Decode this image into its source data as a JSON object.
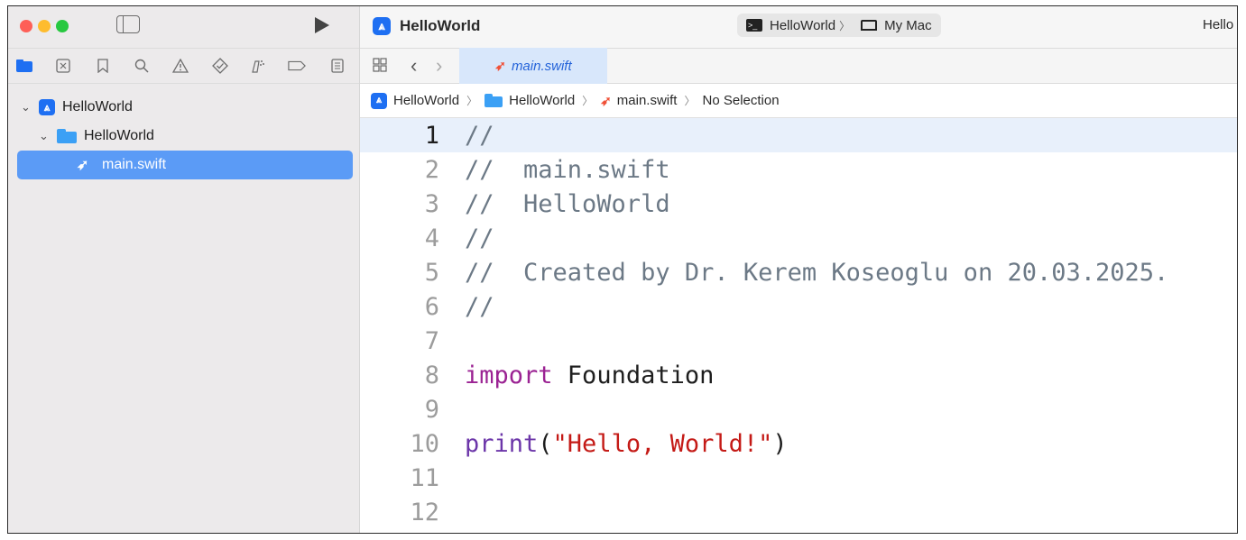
{
  "sidebar": {
    "tree": {
      "project": "HelloWorld",
      "group": "HelloWorld",
      "file": "main.swift"
    }
  },
  "editor": {
    "title": "HelloWorld",
    "scheme": {
      "target": "HelloWorld",
      "sep": "〉",
      "destination": "My Mac"
    },
    "right_label": "Hello",
    "tab": "main.swift",
    "jumpbar": {
      "project": "HelloWorld",
      "group": "HelloWorld",
      "file": "main.swift",
      "selection": "No Selection",
      "sep": "〉"
    },
    "lines": [
      {
        "n": "1",
        "segments": [
          {
            "t": "//",
            "c": "comment"
          }
        ]
      },
      {
        "n": "2",
        "segments": [
          {
            "t": "//  main.swift",
            "c": "comment"
          }
        ]
      },
      {
        "n": "3",
        "segments": [
          {
            "t": "//  HelloWorld",
            "c": "comment"
          }
        ]
      },
      {
        "n": "4",
        "segments": [
          {
            "t": "//",
            "c": "comment"
          }
        ]
      },
      {
        "n": "5",
        "segments": [
          {
            "t": "//  Created by Dr. Kerem Koseoglu on 20.03.2025.",
            "c": "comment"
          }
        ]
      },
      {
        "n": "6",
        "segments": [
          {
            "t": "//",
            "c": "comment"
          }
        ]
      },
      {
        "n": "7",
        "segments": []
      },
      {
        "n": "8",
        "segments": [
          {
            "t": "import",
            "c": "kw"
          },
          {
            "t": " Foundation",
            "c": "plain"
          }
        ]
      },
      {
        "n": "9",
        "segments": []
      },
      {
        "n": "10",
        "segments": [
          {
            "t": "print",
            "c": "fn"
          },
          {
            "t": "(",
            "c": "plain"
          },
          {
            "t": "\"Hello, World!\"",
            "c": "str"
          },
          {
            "t": ")",
            "c": "plain"
          }
        ]
      },
      {
        "n": "11",
        "segments": []
      },
      {
        "n": "12",
        "segments": []
      }
    ]
  },
  "colors": {
    "comment": "#6c7986",
    "keyword": "#9b2393",
    "function": "#6c36a9",
    "string": "#c41a16",
    "selection": "#5b9bf6"
  },
  "icons": [
    "navigator-toggle-icon",
    "run-icon",
    "folder-icon",
    "source-control-icon",
    "bookmark-icon",
    "find-icon",
    "issue-icon",
    "test-icon",
    "debug-icon",
    "breakpoint-icon",
    "report-icon",
    "swift-icon",
    "xcode-project-icon"
  ]
}
